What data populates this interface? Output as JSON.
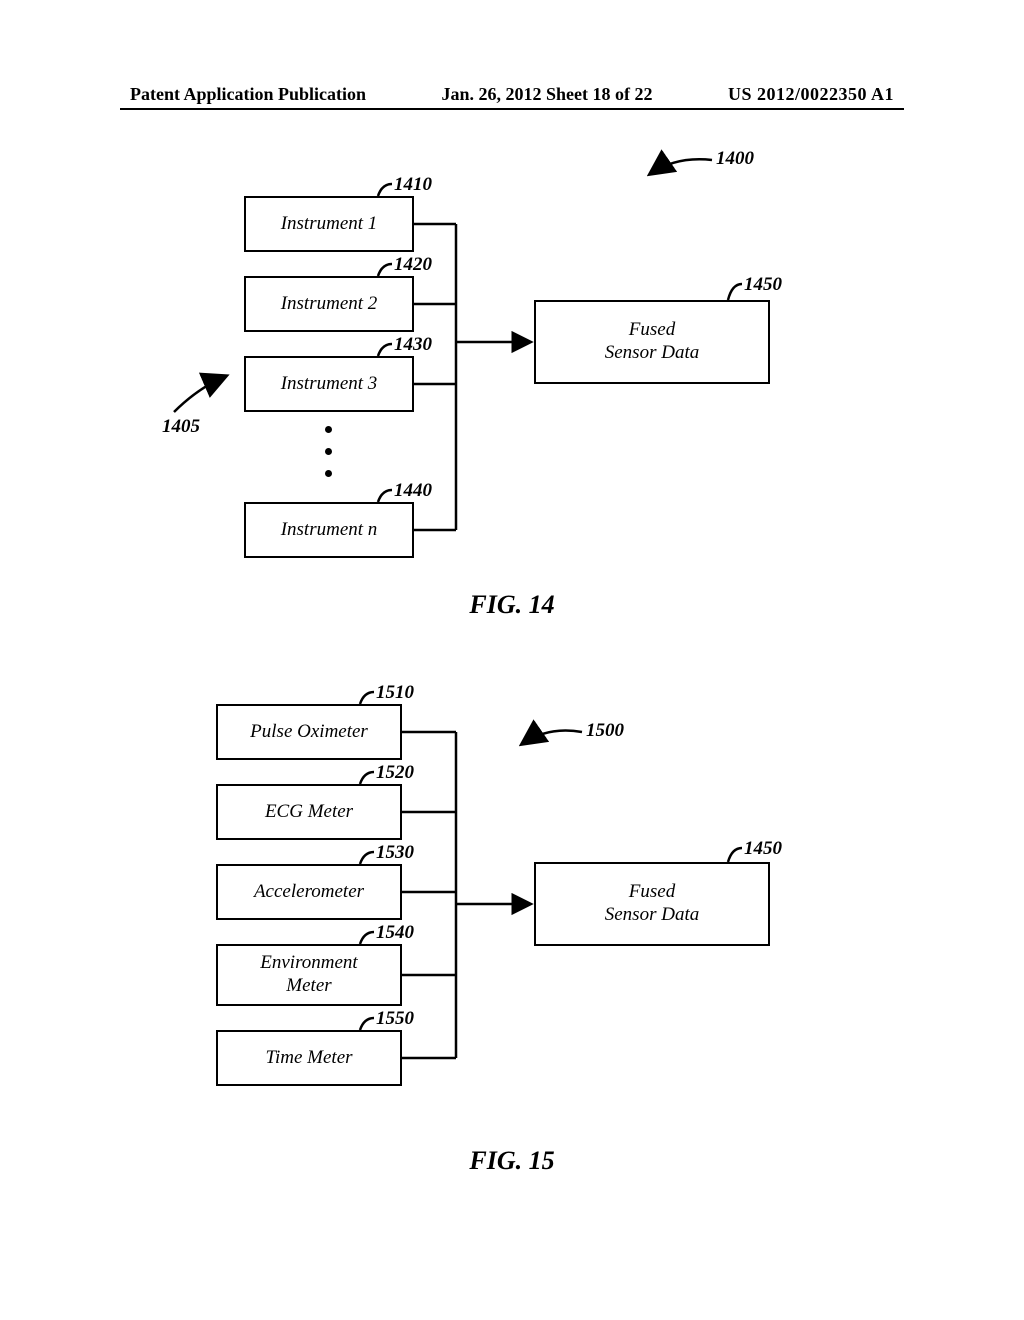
{
  "header": {
    "left": "Patent Application Publication",
    "middle": "Jan. 26, 2012  Sheet 18 of 22",
    "right": "US 2012/0022350 A1"
  },
  "fig14": {
    "instruments": [
      "Instrument 1",
      "Instrument 2",
      "Instrument 3",
      "Instrument n"
    ],
    "fused": "Fused\nSensor Data",
    "labels": {
      "r1400": "1400",
      "r1405": "1405",
      "r1410": "1410",
      "r1420": "1420",
      "r1430": "1430",
      "r1440": "1440",
      "r1450": "1450"
    },
    "caption": "FIG. 14"
  },
  "fig15": {
    "instruments": [
      "Pulse Oximeter",
      "ECG Meter",
      "Accelerometer",
      "Environment\nMeter",
      "Time Meter"
    ],
    "fused": "Fused\nSensor Data",
    "labels": {
      "r1500": "1500",
      "r1510": "1510",
      "r1520": "1520",
      "r1530": "1530",
      "r1540": "1540",
      "r1550": "1550",
      "r1450": "1450"
    },
    "caption": "FIG. 15"
  },
  "chart_data": [
    {
      "type": "diagram",
      "figure": "FIG. 14",
      "ref": "1400",
      "group_ref": "1405",
      "nodes": [
        {
          "id": "1410",
          "label": "Instrument 1"
        },
        {
          "id": "1420",
          "label": "Instrument 2"
        },
        {
          "id": "1430",
          "label": "Instrument 3"
        },
        {
          "id": "1440",
          "label": "Instrument n"
        },
        {
          "id": "1450",
          "label": "Fused Sensor Data"
        }
      ],
      "edges": [
        {
          "from": "1410",
          "to": "1450"
        },
        {
          "from": "1420",
          "to": "1450"
        },
        {
          "from": "1430",
          "to": "1450"
        },
        {
          "from": "1440",
          "to": "1450"
        }
      ]
    },
    {
      "type": "diagram",
      "figure": "FIG. 15",
      "ref": "1500",
      "nodes": [
        {
          "id": "1510",
          "label": "Pulse Oximeter"
        },
        {
          "id": "1520",
          "label": "ECG Meter"
        },
        {
          "id": "1530",
          "label": "Accelerometer"
        },
        {
          "id": "1540",
          "label": "Environment Meter"
        },
        {
          "id": "1550",
          "label": "Time Meter"
        },
        {
          "id": "1450",
          "label": "Fused Sensor Data"
        }
      ],
      "edges": [
        {
          "from": "1510",
          "to": "1450"
        },
        {
          "from": "1520",
          "to": "1450"
        },
        {
          "from": "1530",
          "to": "1450"
        },
        {
          "from": "1540",
          "to": "1450"
        },
        {
          "from": "1550",
          "to": "1450"
        }
      ]
    }
  ]
}
